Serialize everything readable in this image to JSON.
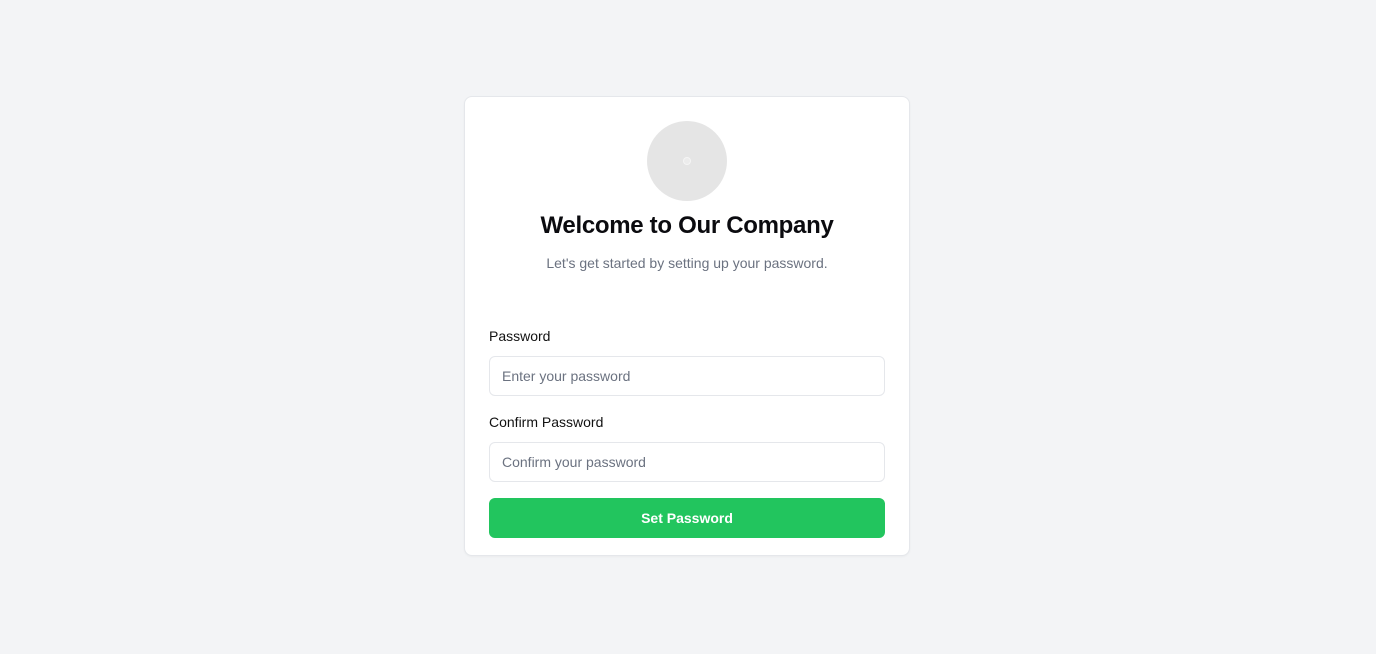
{
  "card": {
    "avatar_icon": "logo-placeholder-icon",
    "title": "Welcome to Our Company",
    "subtitle": "Let's get started by setting up your password."
  },
  "form": {
    "password": {
      "label": "Password",
      "placeholder": "Enter your password",
      "value": ""
    },
    "confirm_password": {
      "label": "Confirm Password",
      "placeholder": "Confirm your password",
      "value": ""
    },
    "submit_label": "Set Password"
  },
  "colors": {
    "background": "#f3f4f6",
    "card": "#ffffff",
    "accent": "#22c55e",
    "muted_text": "#6b7280"
  }
}
